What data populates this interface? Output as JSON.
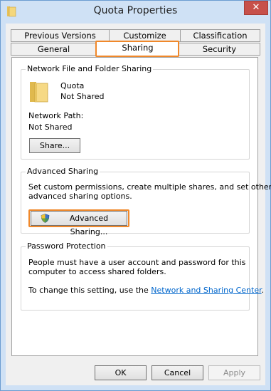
{
  "window": {
    "title": "Quota Properties",
    "close_label": "✕"
  },
  "tabs": {
    "row1": [
      "Previous Versions",
      "Customize",
      "Classification"
    ],
    "row2": [
      "General",
      "Sharing",
      "Security"
    ],
    "selected": "Sharing"
  },
  "network_sharing": {
    "group_title": "Network File and Folder Sharing",
    "folder_name": "Quota",
    "status": "Not Shared",
    "path_label": "Network Path:",
    "path_value": "Not Shared",
    "share_button": "Share..."
  },
  "advanced_sharing": {
    "group_title": "Advanced Sharing",
    "desc_line1": "Set custom permissions, create multiple shares, and set other",
    "desc_line2": "advanced sharing options.",
    "button": "Advanced Sharing..."
  },
  "password_protection": {
    "group_title": "Password Protection",
    "line1": "People must have a user account and password for this",
    "line2": "computer to access shared folders.",
    "line3_prefix": "To change this setting, use the",
    "link": "Network and Sharing Center",
    "line3_suffix": "."
  },
  "footer": {
    "ok": "OK",
    "cancel": "Cancel",
    "apply": "Apply"
  }
}
